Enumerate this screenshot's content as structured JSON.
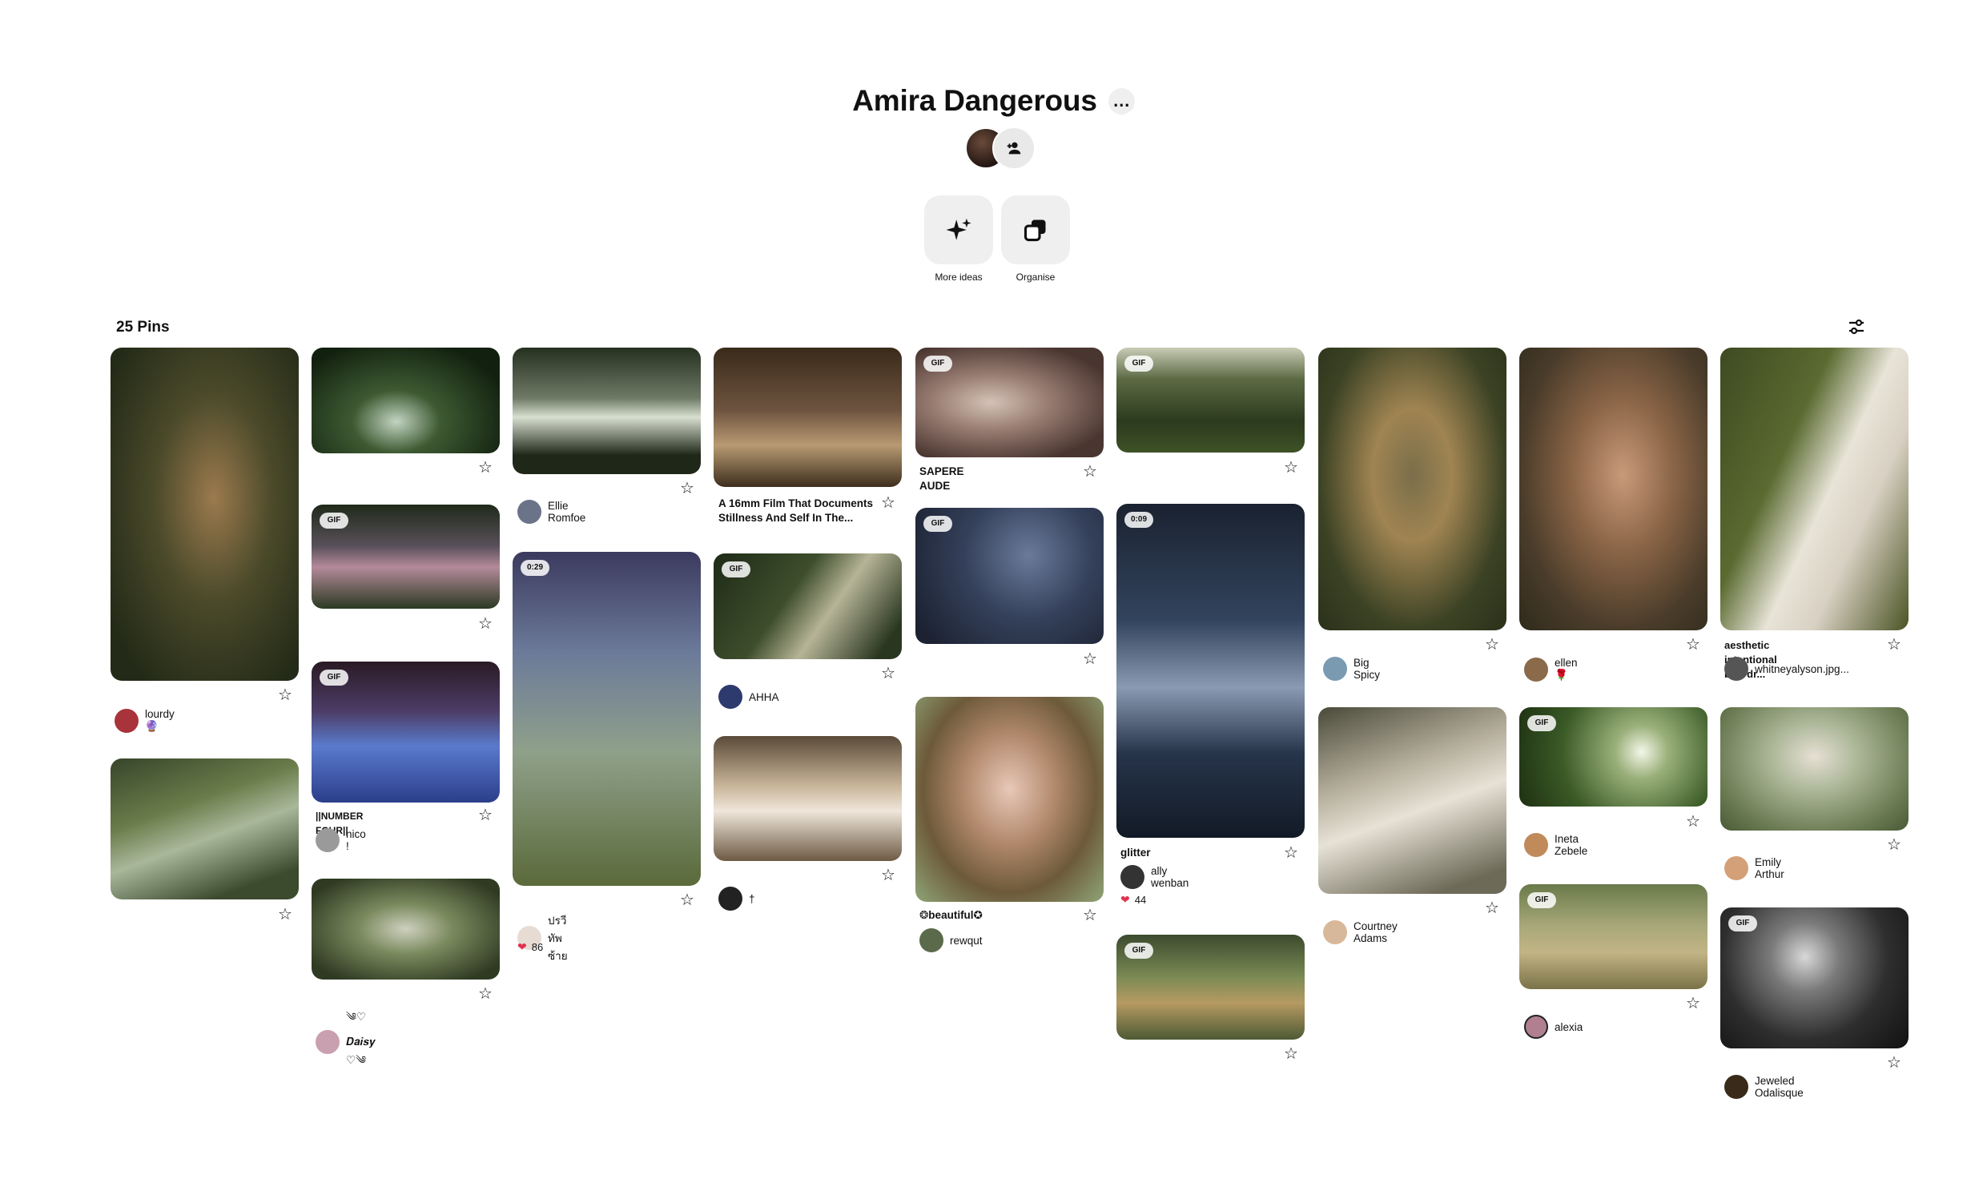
{
  "board": {
    "title": "Amira Dangerous",
    "more_icon": "…",
    "actions": [
      {
        "label": "More ideas",
        "icon": "sparkle-icon"
      },
      {
        "label": "Organise",
        "icon": "organise-icon"
      }
    ],
    "pin_count": "25 Pins"
  },
  "pins": [
    {
      "id": "p1",
      "creator": "lourdy 🔮",
      "badge": "",
      "title": "",
      "reactions": ""
    },
    {
      "id": "p2",
      "creator": "",
      "badge": "",
      "title": "",
      "reactions": ""
    },
    {
      "id": "p3",
      "creator": "",
      "badge": "",
      "title": "",
      "reactions": ""
    },
    {
      "id": "p4",
      "creator": "",
      "badge": "GIF",
      "title": "",
      "reactions": ""
    },
    {
      "id": "p5",
      "creator": "nico !",
      "badge": "GIF",
      "title": "||NUMBER FOUR||",
      "reactions": ""
    },
    {
      "id": "p6",
      "creator": "༄♡ 𝑫𝒂𝒊𝒔𝒚 ♡༄",
      "badge": "",
      "title": "",
      "reactions": ""
    },
    {
      "id": "p7",
      "creator": "Ellie Romfoe",
      "badge": "",
      "title": "",
      "reactions": ""
    },
    {
      "id": "p8",
      "creator": "ปรวี ทัพซ้าย",
      "badge": "0:29",
      "title": "",
      "reactions": "86"
    },
    {
      "id": "p9",
      "creator": "",
      "badge": "",
      "title": "A 16mm Film That Documents Stillness And Self In The...",
      "reactions": ""
    },
    {
      "id": "p10",
      "creator": "AHHA",
      "badge": "GIF",
      "title": "",
      "reactions": ""
    },
    {
      "id": "p11",
      "creator": "†",
      "badge": "",
      "title": "",
      "reactions": ""
    },
    {
      "id": "p12",
      "creator": "",
      "badge": "GIF",
      "title": "SAPERE AUDE",
      "reactions": ""
    },
    {
      "id": "p13",
      "creator": "",
      "badge": "GIF",
      "title": "",
      "reactions": ""
    },
    {
      "id": "p14",
      "creator": "rewqut",
      "badge": "",
      "title": "❂beautiful✪",
      "reactions": ""
    },
    {
      "id": "p15",
      "creator": "",
      "badge": "GIF",
      "title": "",
      "reactions": ""
    },
    {
      "id": "p16",
      "creator": "ally wenban",
      "badge": "0:09",
      "title": "glitter",
      "reactions": "44"
    },
    {
      "id": "p17",
      "creator": "",
      "badge": "GIF",
      "title": "",
      "reactions": ""
    },
    {
      "id": "p18",
      "creator": "Big Spicy",
      "badge": "",
      "title": "",
      "reactions": ""
    },
    {
      "id": "p19",
      "creator": "Courtney Adams",
      "badge": "",
      "title": "",
      "reactions": ""
    },
    {
      "id": "p20",
      "creator": "ellen 🌹",
      "badge": "",
      "title": "",
      "reactions": ""
    },
    {
      "id": "p21",
      "creator": "Ineta Zebele",
      "badge": "GIF",
      "title": "",
      "reactions": ""
    },
    {
      "id": "p22",
      "creator": "alexia",
      "badge": "GIF",
      "title": "",
      "reactions": ""
    },
    {
      "id": "p23",
      "creator": "whitneyalyson.jpg...",
      "badge": "",
      "title": "aesthetic intentional blur dr...",
      "reactions": ""
    },
    {
      "id": "p24",
      "creator": "Emily Arthur",
      "badge": "",
      "title": "",
      "reactions": ""
    },
    {
      "id": "p25",
      "creator": "Jeweled Odalisque",
      "badge": "GIF",
      "title": "",
      "reactions": ""
    }
  ]
}
